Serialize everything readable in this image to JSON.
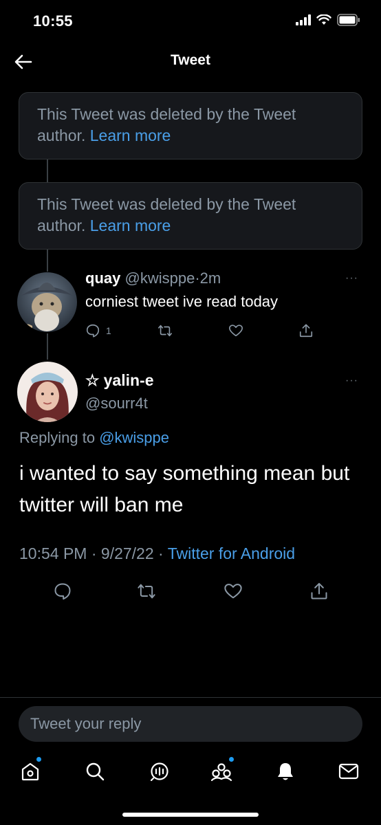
{
  "status_bar": {
    "time": "10:55"
  },
  "header": {
    "title": "Tweet"
  },
  "deleted_tweets": [
    {
      "text": "This Tweet was deleted by the Tweet author.",
      "link": "Learn more"
    },
    {
      "text": "This Tweet was deleted by the Tweet author.",
      "link": "Learn more"
    }
  ],
  "reply": {
    "name": "quay",
    "handle": "@kwisppe",
    "separator": "·",
    "time": "2m",
    "text": "corniest tweet ive read today",
    "reply_count": "1"
  },
  "main_tweet": {
    "star": "☆",
    "name": "yalin-e",
    "handle": "@sourr4t",
    "replying_prefix": "Replying to",
    "replying_to": "@kwisppe",
    "text": "i wanted to say something mean but twitter will ban me",
    "time": "10:54 PM",
    "sep1": "·",
    "date": "9/27/22",
    "sep2": "·",
    "source": "Twitter for Android"
  },
  "composer": {
    "placeholder": "Tweet your reply"
  },
  "more_label": "···",
  "colors": {
    "accent": "#1d9bf0",
    "link": "#4a9fe8",
    "background": "#000000"
  }
}
